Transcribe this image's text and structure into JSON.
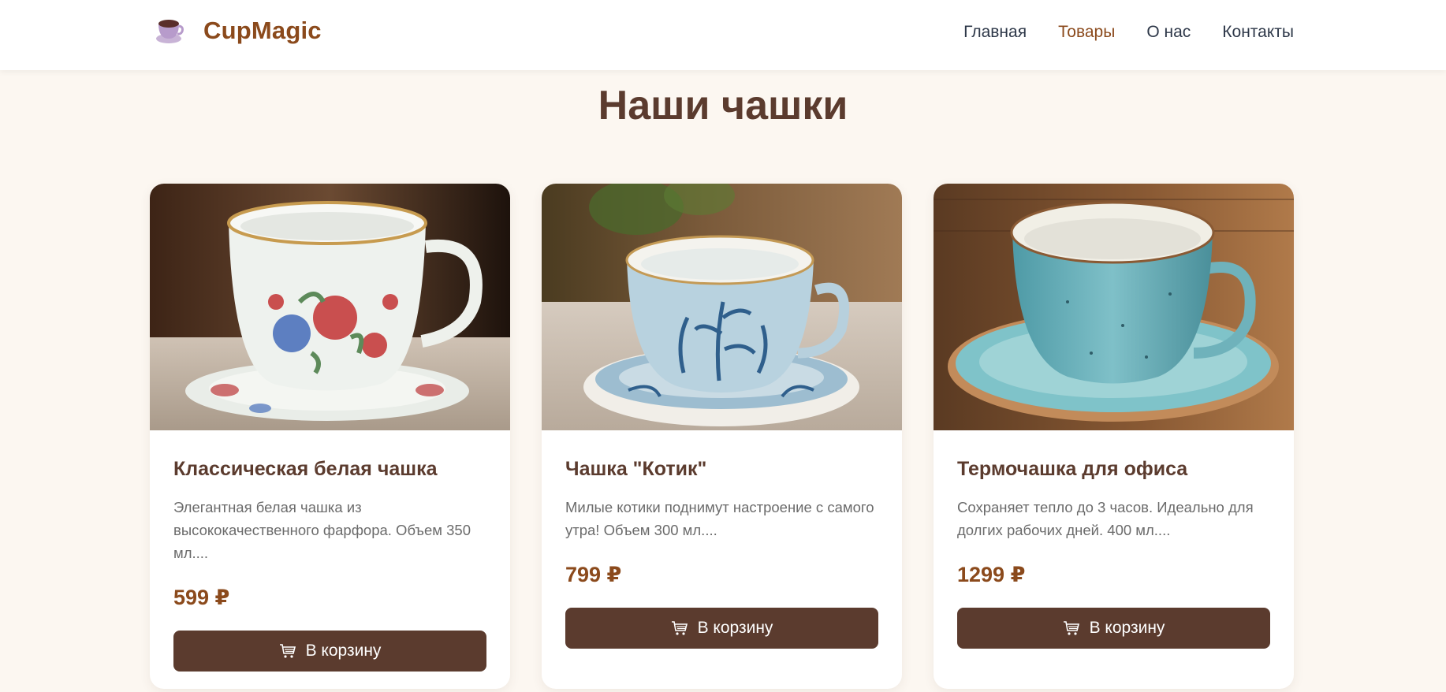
{
  "header": {
    "logo_text": "CupMagic",
    "logo_icon": "coffee-cup-icon",
    "nav": [
      {
        "label": "Главная",
        "active": false
      },
      {
        "label": "Товары",
        "active": true
      },
      {
        "label": "О нас",
        "active": false
      },
      {
        "label": "Контакты",
        "active": false
      }
    ]
  },
  "main": {
    "title": "Наши чашки",
    "products": [
      {
        "name": "Классическая белая чашка",
        "description": "Элегантная белая чашка из высококачественного фарфора. Объем 350 мл....",
        "price": "599 ₽",
        "button_label": "В корзину",
        "button_icon": "shopping-cart-icon",
        "image": "white-floral-porcelain-cup-photo"
      },
      {
        "name": "Чашка \"Котик\"",
        "description": "Милые котики поднимут настроение с самого утра! Объем 300 мл....",
        "price": "799 ₽",
        "button_label": "В корзину",
        "button_icon": "shopping-cart-icon",
        "image": "blue-floral-cup-photo"
      },
      {
        "name": "Термочашка для офиса",
        "description": "Сохраняет тепло до 3 часов. Идеально для долгих рабочих дней. 400 мл....",
        "price": "1299 ₽",
        "button_label": "В корзину",
        "button_icon": "shopping-cart-icon",
        "image": "turquoise-speckled-cup-photo"
      }
    ]
  },
  "colors": {
    "brand": "#8b4a1c",
    "primary_dark": "#5b3b2e",
    "page_background": "#fcf7f1",
    "nav_text": "#2d3748"
  }
}
